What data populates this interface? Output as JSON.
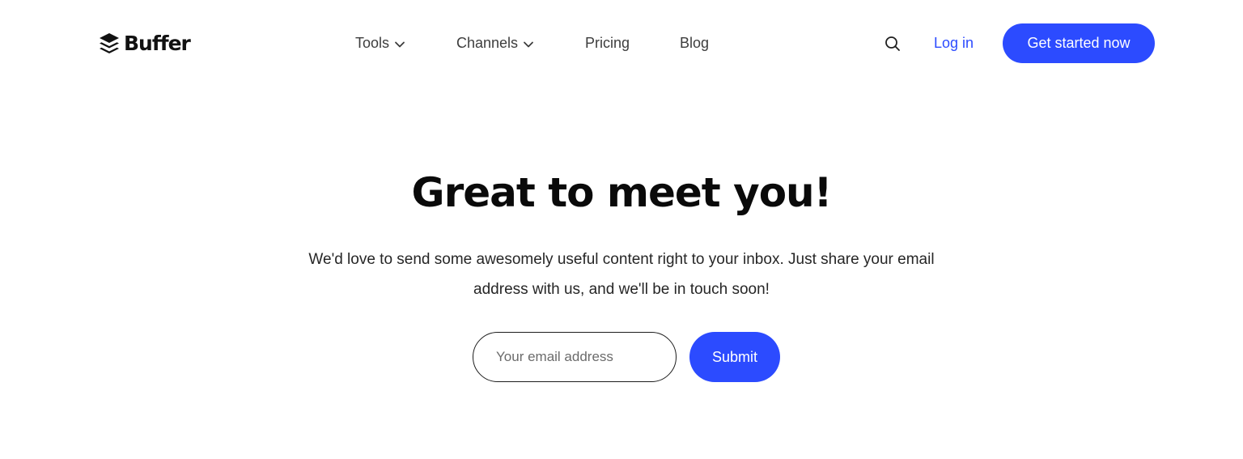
{
  "theme": {
    "accent": "#2c4bff",
    "text": "#1f1f1f",
    "background": "#ffffff"
  },
  "header": {
    "logo_text": "Buffer",
    "logo_icon": "buffer-stack-icon",
    "nav": [
      {
        "label": "Tools",
        "has_dropdown": true,
        "icon": "chevron-down-icon"
      },
      {
        "label": "Channels",
        "has_dropdown": true,
        "icon": "chevron-down-icon"
      },
      {
        "label": "Pricing",
        "has_dropdown": false
      },
      {
        "label": "Blog",
        "has_dropdown": false
      }
    ],
    "search_icon": "search-icon",
    "login_label": "Log in",
    "cta_label": "Get started now"
  },
  "hero": {
    "title": "Great to meet you!",
    "text": "We'd love to send some awesomely useful content right to your inbox. Just share your email address with us, and we'll be in touch soon!"
  },
  "form": {
    "email_placeholder": "Your email address",
    "email_value": "",
    "submit_label": "Submit"
  }
}
